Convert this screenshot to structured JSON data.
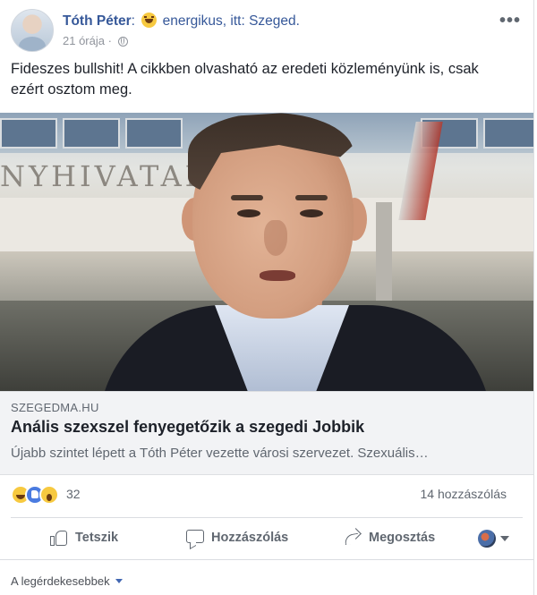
{
  "post": {
    "author": "Tóth Péter",
    "colon": ":",
    "feeling": "energikus, itt: Szeged.",
    "time": "21 órája",
    "separator": "·",
    "audience_icon": "globe-icon",
    "more_icon": "more-options-icon",
    "text": "Fideszes bullshit! A cikkben olvasható az eredeti közleményünk is, csak ezért osztom meg."
  },
  "link_preview": {
    "image_sign": "NYHIVATAL",
    "domain": "SZEGEDMA.HU",
    "title": "Anális szexszel fenyegetőzik a szegedi Jobbik",
    "description": "Újabb szintet lépett a Tóth Péter vezette városi szervezet. Szexuális…"
  },
  "engagement": {
    "reaction_icons": [
      "haha-reaction-icon",
      "like-reaction-icon",
      "wow-reaction-icon"
    ],
    "reaction_count": "32",
    "comments": "14 hozzászólás"
  },
  "actions": {
    "like": "Tetszik",
    "comment": "Hozzászólás",
    "share": "Megosztás"
  },
  "comments_sort": {
    "label": "A legérdekesebbek"
  },
  "colors": {
    "link_blue": "#365899",
    "meta_gray": "#90949c",
    "preview_bg": "#f2f3f5"
  }
}
